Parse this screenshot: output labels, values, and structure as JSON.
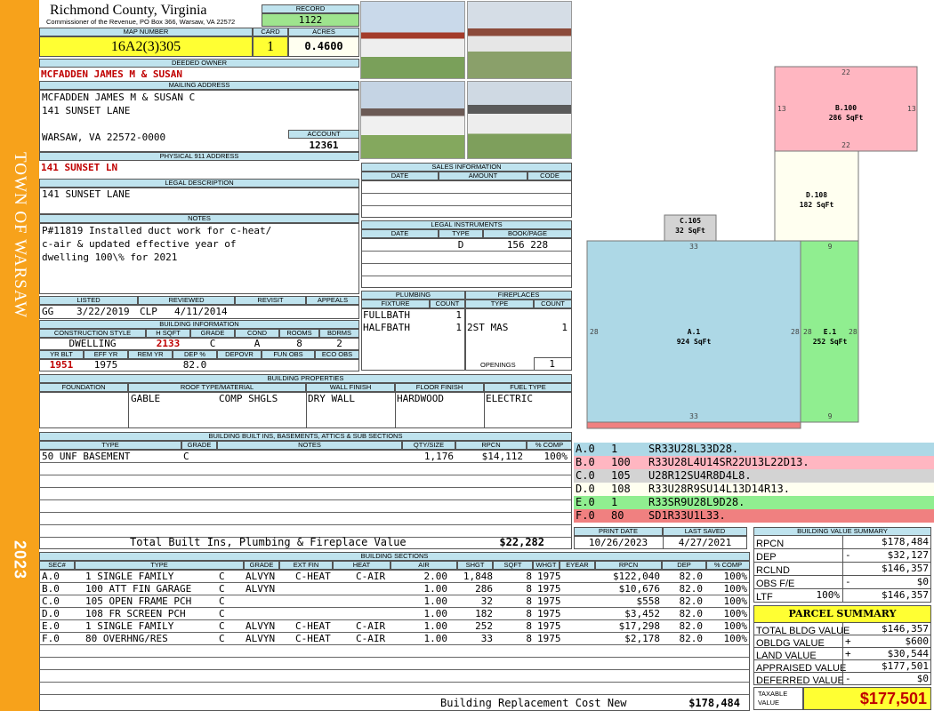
{
  "sidebar": {
    "town": "TOWN OF WARSAW",
    "year": "2023"
  },
  "header": {
    "county": "Richmond County, Virginia",
    "commissioner": "Commissioner of the Revenue, PO Box 366, Warsaw, VA 22572",
    "record_label": "RECORD",
    "record": "1122",
    "map_label": "MAP NUMBER",
    "map_number": "16A2(3)305",
    "card_label": "CARD",
    "card": "1",
    "acres_label": "ACRES",
    "acres": "0.4600"
  },
  "owner": {
    "deeded_label": "DEEDED OWNER",
    "deeded_owner": "MCFADDEN JAMES M & SUSAN",
    "mailing_label": "MAILING ADDRESS",
    "mail_line1": "MCFADDEN JAMES M & SUSAN C",
    "mail_line2": "141 SUNSET LANE",
    "mail_line3": "WARSAW, VA 22572-0000",
    "account_label": "ACCOUNT",
    "account": "12361",
    "physical_label": "PHYSICAL 911 ADDRESS",
    "physical_address": "141 SUNSET LN",
    "legal_label": "LEGAL DESCRIPTION",
    "legal": "141 SUNSET LANE",
    "notes_label": "NOTES",
    "notes1": "P#11819 Installed duct work for c-heat/",
    "notes2": "c-air & updated effective year of",
    "notes3": "dwelling 100\\% for 2021"
  },
  "listing": {
    "listed_label": "LISTED",
    "listed_by": "GG",
    "listed_date": "3/22/2019",
    "reviewed_label": "REVIEWED",
    "reviewed_by": "CLP",
    "reviewed_date": "4/11/2014",
    "revisit_label": "REVISIT",
    "appeals_label": "APPEALS"
  },
  "building_info": {
    "title": "BUILDING INFORMATION",
    "h_construction": "CONSTRUCTION STYLE",
    "h_sqft": "H SQFT",
    "h_grade": "GRADE",
    "h_cond": "COND",
    "h_rooms": "ROOMS",
    "h_bdrms": "BDRMS",
    "construction": "DWELLING",
    "sqft": "2133",
    "grade": "C",
    "cond": "A",
    "rooms": "8",
    "bdrms": "2",
    "h_yrblt": "YR BLT",
    "h_effyr": "EFF YR",
    "h_remyr": "REM YR",
    "h_dep": "DEP %",
    "h_depovr": "DEPOVR",
    "h_funobs": "FUN OBS",
    "h_ecoobs": "ECO OBS",
    "yr_blt": "1951",
    "eff_yr": "1975",
    "dep": "82.0"
  },
  "sales": {
    "title": "SALES INFORMATION",
    "h_date": "DATE",
    "h_amount": "AMOUNT",
    "h_code": "CODE"
  },
  "legal_instruments": {
    "title": "LEGAL INSTRUMENTS",
    "h_date": "DATE",
    "h_type": "TYPE",
    "h_bookpage": "BOOK/PAGE",
    "type": "D",
    "bookpage": "156 228"
  },
  "plumbing": {
    "title": "PLUMBING",
    "h_fixture": "FIXTURE",
    "h_count": "COUNT",
    "rows": [
      {
        "fixture": "FULLBATH",
        "count": "1"
      },
      {
        "fixture": "HALFBATH",
        "count": "1"
      }
    ]
  },
  "fireplaces": {
    "title": "FIREPLACES",
    "h_type": "TYPE",
    "h_count": "COUNT",
    "type": "2ST MAS",
    "count": "1",
    "openings_label": "OPENINGS",
    "openings": "1"
  },
  "building_props": {
    "title": "BUILDING PROPERTIES",
    "h_foundation": "FOUNDATION",
    "h_roof": "ROOF TYPE/MATERIAL",
    "h_wall": "WALL FINISH",
    "h_floor": "FLOOR FINISH",
    "h_fuel": "FUEL TYPE",
    "roof_type": "GABLE",
    "roof_material": "COMP SHGLS",
    "wall": "DRY WALL",
    "floor": "HARDWOOD",
    "fuel": "ELECTRIC"
  },
  "builtins": {
    "title": "BUILDING BUILT INS, BASEMENTS, ATTICS & SUB SECTIONS",
    "h_type": "TYPE",
    "h_grade": "GRADE",
    "h_notes": "NOTES",
    "h_qty": "QTY/SIZE",
    "h_rpcn": "RPCN",
    "h_comp": "% COMP",
    "type": "50 UNF BASEMENT",
    "grade": "C",
    "qty": "1,176",
    "rpcn": "$14,112",
    "comp": "100%",
    "total_label": "Total Built Ins, Plumbing & Fireplace Value",
    "total": "$22,282"
  },
  "sketch": {
    "labels": [
      {
        "id": "B.100",
        "area": "286 SqFt"
      },
      {
        "id": "D.108",
        "area": "182 SqFt"
      },
      {
        "id": "C.105",
        "area": "32 SqFt"
      },
      {
        "id": "A.1",
        "area": "924 SqFt"
      },
      {
        "id": "E.1",
        "area": "252 SqFt"
      }
    ],
    "dims": {
      "b_top": "22",
      "b_left": "13",
      "b_right": "13",
      "b_bottom": "22",
      "a_top": "33",
      "a_left": "28",
      "a_right": "28",
      "a_bottom": "33",
      "e_top": "9",
      "e_left": "28",
      "e_right": "28",
      "e_bottom": "9"
    },
    "colors": {
      "A": "#add8e6",
      "B": "#ffb6c1",
      "C": "#d3d3d3",
      "D": "#fffff0",
      "E": "#90ee90",
      "F": "#f08080"
    }
  },
  "legend": [
    {
      "sec": "A.0",
      "code": "1",
      "path": "SR33U28L33D28."
    },
    {
      "sec": "B.0",
      "code": "100",
      "path": "R33U28L4U14SR22U13L22D13."
    },
    {
      "sec": "C.0",
      "code": "105",
      "path": "U28R12SU4R8D4L8."
    },
    {
      "sec": "D.0",
      "code": "108",
      "path": "R33U28R9SU14L13D14R13."
    },
    {
      "sec": "E.0",
      "code": "1",
      "path": "R33SR9U28L9D28."
    },
    {
      "sec": "F.0",
      "code": "80",
      "path": "SD1R33U1L33."
    }
  ],
  "dates": {
    "print_label": "PRINT DATE",
    "print_date": "10/26/2023",
    "saved_label": "LAST SAVED",
    "saved_date": "4/27/2021"
  },
  "value_summary": {
    "title": "BUILDING VALUE SUMMARY",
    "rows": [
      {
        "label": "RPCN",
        "sign": "",
        "pct": "",
        "value": "$178,484"
      },
      {
        "label": "DEP",
        "sign": "-",
        "pct": "",
        "value": "$32,127"
      },
      {
        "label": "RCLND",
        "sign": "",
        "pct": "",
        "value": "$146,357"
      },
      {
        "label": "OBS F/E",
        "sign": "-",
        "pct": "",
        "value": "$0"
      },
      {
        "label": "LTF",
        "sign": "",
        "pct": "100%",
        "value": "$146,357"
      }
    ]
  },
  "parcel": {
    "title": "PARCEL SUMMARY",
    "rows": [
      {
        "label": "TOTAL BLDG VALUE",
        "sign": "",
        "value": "$146,357"
      },
      {
        "label": "OBLDG VALUE",
        "sign": "+",
        "value": "$600"
      },
      {
        "label": "LAND VALUE",
        "sign": "+",
        "value": "$30,544"
      },
      {
        "label": "APPRAISED VALUE",
        "sign": "",
        "value": "$177,501"
      },
      {
        "label": "DEFERRED VALUE",
        "sign": "-",
        "value": "$0"
      }
    ],
    "taxable_label1": "TAXABLE",
    "taxable_label2": "VALUE",
    "taxable": "$177,501"
  },
  "sections": {
    "title": "BUILDING SECTIONS",
    "headers": {
      "sec": "SEC#",
      "type": "TYPE",
      "grade": "GRADE",
      "extfin": "EXT FIN",
      "heat": "HEAT",
      "air": "AIR",
      "shgt": "SHGT",
      "sqft": "SQFT",
      "whgt": "WHGT",
      "eyear": "EYEAR",
      "rpcn": "RPCN",
      "dep": "DEP",
      "comp": "% COMP"
    },
    "rows": [
      {
        "sec": "A.0",
        "type": "1 SINGLE FAMILY",
        "grade": "C",
        "extfin": "ALVYN",
        "heat": "C-HEAT",
        "air": "C-AIR",
        "shgt": "2.00",
        "sqft": "1,848",
        "whgt": "8",
        "eyear": "1975",
        "rpcn": "$122,040",
        "dep": "82.0",
        "comp": "100%"
      },
      {
        "sec": "B.0",
        "type": "100 ATT FIN GARAGE",
        "grade": "C",
        "extfin": "ALVYN",
        "heat": "",
        "air": "",
        "shgt": "1.00",
        "sqft": "286",
        "whgt": "8",
        "eyear": "1975",
        "rpcn": "$10,676",
        "dep": "82.0",
        "comp": "100%"
      },
      {
        "sec": "C.0",
        "type": "105 OPEN FRAME PCH",
        "grade": "C",
        "extfin": "",
        "heat": "",
        "air": "",
        "shgt": "1.00",
        "sqft": "32",
        "whgt": "8",
        "eyear": "1975",
        "rpcn": "$558",
        "dep": "82.0",
        "comp": "100%"
      },
      {
        "sec": "D.0",
        "type": "108 FR SCREEN PCH",
        "grade": "C",
        "extfin": "",
        "heat": "",
        "air": "",
        "shgt": "1.00",
        "sqft": "182",
        "whgt": "8",
        "eyear": "1975",
        "rpcn": "$3,452",
        "dep": "82.0",
        "comp": "100%"
      },
      {
        "sec": "E.0",
        "type": "1 SINGLE FAMILY",
        "grade": "C",
        "extfin": "ALVYN",
        "heat": "C-HEAT",
        "air": "C-AIR",
        "shgt": "1.00",
        "sqft": "252",
        "whgt": "8",
        "eyear": "1975",
        "rpcn": "$17,298",
        "dep": "82.0",
        "comp": "100%"
      },
      {
        "sec": "F.0",
        "type": "80 OVERHNG/RES",
        "grade": "C",
        "extfin": "ALVYN",
        "heat": "C-HEAT",
        "air": "C-AIR",
        "shgt": "1.00",
        "sqft": "33",
        "whgt": "8",
        "eyear": "1975",
        "rpcn": "$2,178",
        "dep": "82.0",
        "comp": "100%"
      }
    ],
    "replacement_label": "Building Replacement Cost New",
    "replacement": "$178,484"
  }
}
